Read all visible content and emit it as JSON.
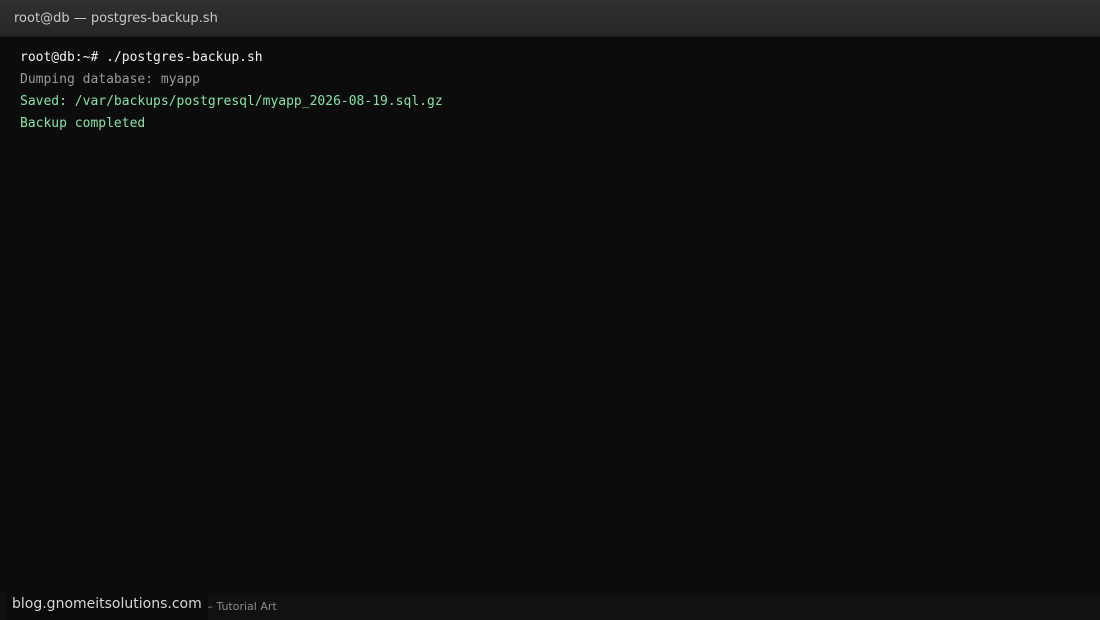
{
  "window": {
    "title": "root@db — postgres-backup.sh"
  },
  "terminal": {
    "lines": [
      "root@db:~# ./postgres-backup.sh",
      "Dumping database: myapp",
      "Saved: /var/backups/postgresql/myapp_2026-08-19.sql.gz",
      "Backup completed"
    ],
    "colors": {
      "background": "#0c0c0c",
      "command": "#f2f2f2",
      "info": "#9a9a9a",
      "success": "#86e3a4"
    }
  },
  "footer": {
    "caption": "Illustration by Gnome IT Solutions — Tutorial Art",
    "watermark": "blog.gnomeitsolutions.com"
  }
}
